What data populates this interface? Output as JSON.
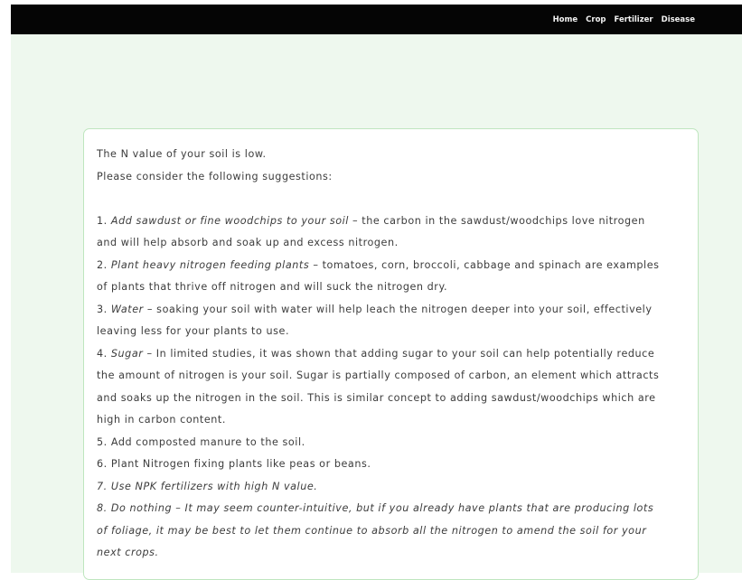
{
  "nav": {
    "links": [
      "Home",
      "Crop",
      "Fertilizer",
      "Disease"
    ]
  },
  "content": {
    "intro1": "The N value of your soil is low.",
    "intro2": "Please consider the following suggestions:",
    "s1_num": "1.",
    "s1_title": "Add sawdust or fine woodchips to your soil",
    "s1_rest": " – the carbon in the sawdust/woodchips love nitrogen",
    "s1_line2": "and will help absorb and soak up and excess nitrogen.",
    "s2_num": "2.",
    "s2_title": "Plant heavy nitrogen feeding plants",
    "s2_rest": " – tomatoes, corn, broccoli, cabbage and spinach are examples",
    "s2_line2": "of plants that thrive off nitrogen and will suck the nitrogen dry.",
    "s3_num": "3.",
    "s3_title": "Water",
    "s3_rest": " – soaking your soil with water will help leach the nitrogen deeper into your soil, effectively",
    "s3_line2": "leaving less for your plants to use.",
    "s4_num": "4.",
    "s4_title": "Sugar",
    "s4_rest": " – In limited studies, it was shown that adding sugar to your soil can help potentially reduce",
    "s4_line2": "the amount of nitrogen is your soil. Sugar is partially composed of carbon, an element which attracts",
    "s4_line3": "and soaks up the nitrogen in the soil. This is similar concept to adding sawdust/woodchips which are",
    "s4_line4": "high in carbon content.",
    "s5": "5. Add composted manure to the soil.",
    "s6": "6. Plant Nitrogen fixing plants like peas or beans.",
    "s7": "7. Use NPK fertilizers with high N value.",
    "s8_line1": "8. Do nothing – It may seem counter-intuitive, but if you already have plants that are producing lots",
    "s8_line2": "of foliage, it may be best to let them continue to absorb all the nitrogen to amend the soil for your",
    "s8_line3": "next crops."
  }
}
